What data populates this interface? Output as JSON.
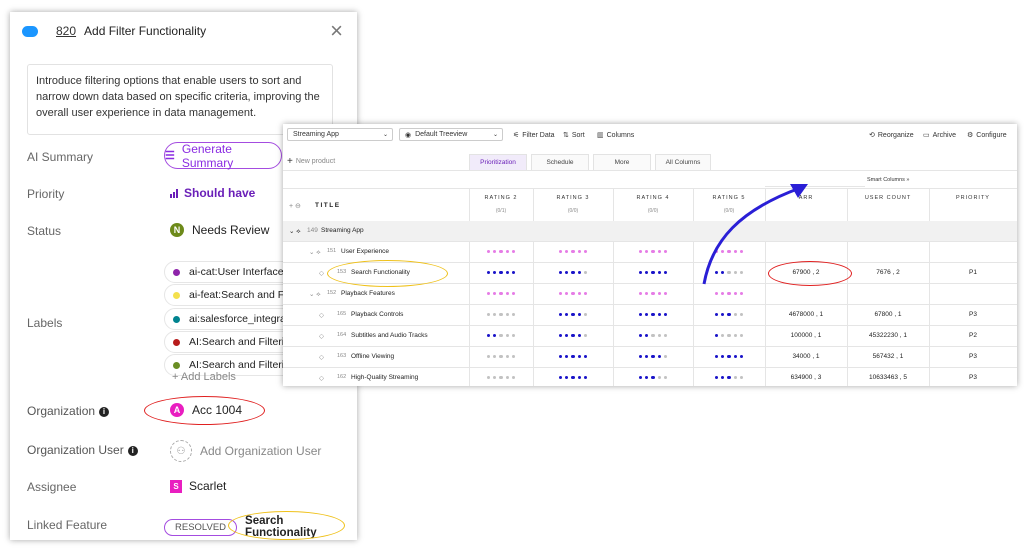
{
  "detail": {
    "item_number": "820",
    "title": "Add Filter Functionality",
    "close_glyph": "×",
    "description": "Introduce filtering options that enable users to sort and narrow down data based on specific criteria, improving the overall user experience in data management.",
    "fields": {
      "ai_summary_label": "AI Summary",
      "generate_summary": "Generate Summary",
      "priority_label": "Priority",
      "priority_value": "Should have",
      "status_label": "Status",
      "status_badge": "N",
      "status_value": "Needs Review",
      "labels_label": "Labels",
      "labels": [
        {
          "text": "ai-cat:User Interface Enha",
          "color": "#8e24aa"
        },
        {
          "text": "ai-feat:Search and Filter O",
          "color": "#f4e04d"
        },
        {
          "text": "ai:salesforce_integration_",
          "color": "#00838f"
        },
        {
          "text": "AI:Search and Filtering Ca",
          "color": "#b71c1c"
        },
        {
          "text": "AI:Search and Filtering Fe",
          "color": "#6a8e23"
        }
      ],
      "add_labels": "+ Add Labels",
      "organization_label": "Organization",
      "organization_badge": "A",
      "organization_value": "Acc 1004",
      "org_user_label": "Organization User",
      "org_user_value": "Add Organization User",
      "assignee_label": "Assignee",
      "assignee_badge": "S",
      "assignee_value": "Scarlet",
      "linked_label": "Linked Feature",
      "linked_status": "RESOLVED",
      "linked_value": "Search Functionality"
    }
  },
  "table": {
    "toolbar": {
      "app_select": "Streaming App",
      "view_select": "Default Treeview",
      "filter": "Filter Data",
      "sort": "Sort",
      "columns": "Columns",
      "reorganize": "Reorganize",
      "archive": "Archive",
      "configure": "Configure"
    },
    "new_product": "New product",
    "tabs": [
      "Prioritization",
      "Schedule",
      "More",
      "All Columns"
    ],
    "smart_columns": "Smart Columns",
    "title_header": "TITLE",
    "columns": [
      {
        "name": "RATING 2",
        "sub": "(0/1)"
      },
      {
        "name": "RATING 3",
        "sub": "(0/0)"
      },
      {
        "name": "RATING 4",
        "sub": "(0/0)"
      },
      {
        "name": "RATING 5",
        "sub": "(0/0)"
      },
      {
        "name": "ARR",
        "sub": ""
      },
      {
        "name": "USER COUNT",
        "sub": ""
      },
      {
        "name": "PRIORITY",
        "sub": ""
      }
    ],
    "root_row": {
      "id": "149",
      "title": "Streaming App"
    },
    "rows": [
      {
        "kind": "group",
        "id": "151",
        "title": "User Experience",
        "ratings": [
          [
            5,
            "p"
          ],
          [
            5,
            "p"
          ],
          [
            5,
            "p"
          ],
          [
            5,
            "p"
          ]
        ],
        "arr": "",
        "users": "",
        "priority": ""
      },
      {
        "kind": "item",
        "id": "153",
        "title": "Search Functionality",
        "ratings": [
          [
            5,
            "b"
          ],
          [
            4,
            "b"
          ],
          [
            5,
            "b"
          ],
          [
            2,
            "b"
          ]
        ],
        "arr": "67900 , 2",
        "users": "7676 , 2",
        "priority": "P1"
      },
      {
        "kind": "group",
        "id": "152",
        "title": "Playback Features",
        "ratings": [
          [
            5,
            "p"
          ],
          [
            5,
            "p"
          ],
          [
            5,
            "p"
          ],
          [
            5,
            "p"
          ]
        ],
        "arr": "",
        "users": "",
        "priority": ""
      },
      {
        "kind": "item",
        "id": "165",
        "title": "Playback Controls",
        "ratings": [
          [
            0,
            "b"
          ],
          [
            4,
            "b"
          ],
          [
            5,
            "b"
          ],
          [
            3,
            "b"
          ]
        ],
        "arr": "4678000 , 1",
        "users": "67800 , 1",
        "priority": "P3"
      },
      {
        "kind": "item",
        "id": "164",
        "title": "Subtitles and Audio Tracks",
        "ratings": [
          [
            2,
            "b"
          ],
          [
            4,
            "b"
          ],
          [
            2,
            "b"
          ],
          [
            1,
            "b"
          ]
        ],
        "arr": "100000 , 1",
        "users": "45322230 , 1",
        "priority": "P2"
      },
      {
        "kind": "item",
        "id": "163",
        "title": "Offline Viewing",
        "ratings": [
          [
            0,
            "b"
          ],
          [
            5,
            "b"
          ],
          [
            4,
            "b"
          ],
          [
            5,
            "b"
          ]
        ],
        "arr": "34000 , 1",
        "users": "567432 , 1",
        "priority": "P3"
      },
      {
        "kind": "item",
        "id": "162",
        "title": "High-Quality Streaming",
        "ratings": [
          [
            0,
            "b"
          ],
          [
            5,
            "b"
          ],
          [
            3,
            "b"
          ],
          [
            3,
            "b"
          ]
        ],
        "arr": "634900 , 3",
        "users": "10633463 , 5",
        "priority": "P3"
      }
    ]
  },
  "colors": {
    "accent": "#8a2be2",
    "dot_blue": "#1a14c9",
    "dot_pink": "#e67ce6",
    "dot_grey": "#c2c2c2",
    "annotation_red": "#e02020",
    "annotation_yellow": "#efc11a",
    "arrow_blue": "#2a1fd6",
    "status_green": "#6d8a1a",
    "org_pink": "#e91ec0"
  }
}
